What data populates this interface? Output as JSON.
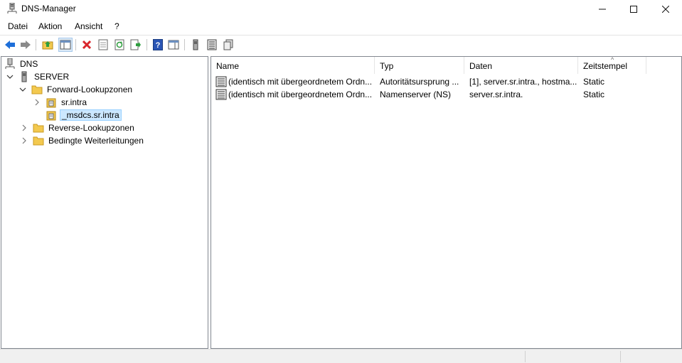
{
  "window": {
    "title": "DNS-Manager",
    "controls": {
      "minimize": "—",
      "maximize": "☐",
      "close": "✕"
    }
  },
  "menu": [
    "Datei",
    "Aktion",
    "Ansicht",
    "?"
  ],
  "toolbar": {
    "buttons": [
      "back-icon",
      "forward-icon",
      "up-folder-icon",
      "show-hide-tree-icon",
      "delete-icon",
      "properties-icon",
      "refresh-icon",
      "export-list-icon",
      "help-icon",
      "action-pane-icon",
      "server-icon",
      "record-list-icon",
      "copy-icon"
    ]
  },
  "tree": {
    "root": "DNS",
    "server": "SERVER",
    "forward_zones": "Forward-Lookupzonen",
    "zone1": "sr.intra",
    "zone2": "_msdcs.sr.intra",
    "reverse_zones": "Reverse-Lookupzonen",
    "conditional": "Bedingte Weiterleitungen"
  },
  "list": {
    "columns": [
      "Name",
      "Typ",
      "Daten",
      "Zeitstempel"
    ],
    "sort_indicator": "^",
    "rows": [
      {
        "name": "(identisch mit übergeordnetem Ordn...",
        "type": "Autoritätsursprung ...",
        "data": "[1], server.sr.intra., hostma...",
        "timestamp": "Static"
      },
      {
        "name": "(identisch mit übergeordnetem Ordn...",
        "type": "Namenserver (NS)",
        "data": "server.sr.intra.",
        "timestamp": "Static"
      }
    ]
  },
  "colors": {
    "selection_bg": "#cce8ff",
    "selection_border": "#99d1ff",
    "delete_red": "#d9262c",
    "nav_blue": "#1e6fd9",
    "folder_yellow": "#f3c94f"
  }
}
